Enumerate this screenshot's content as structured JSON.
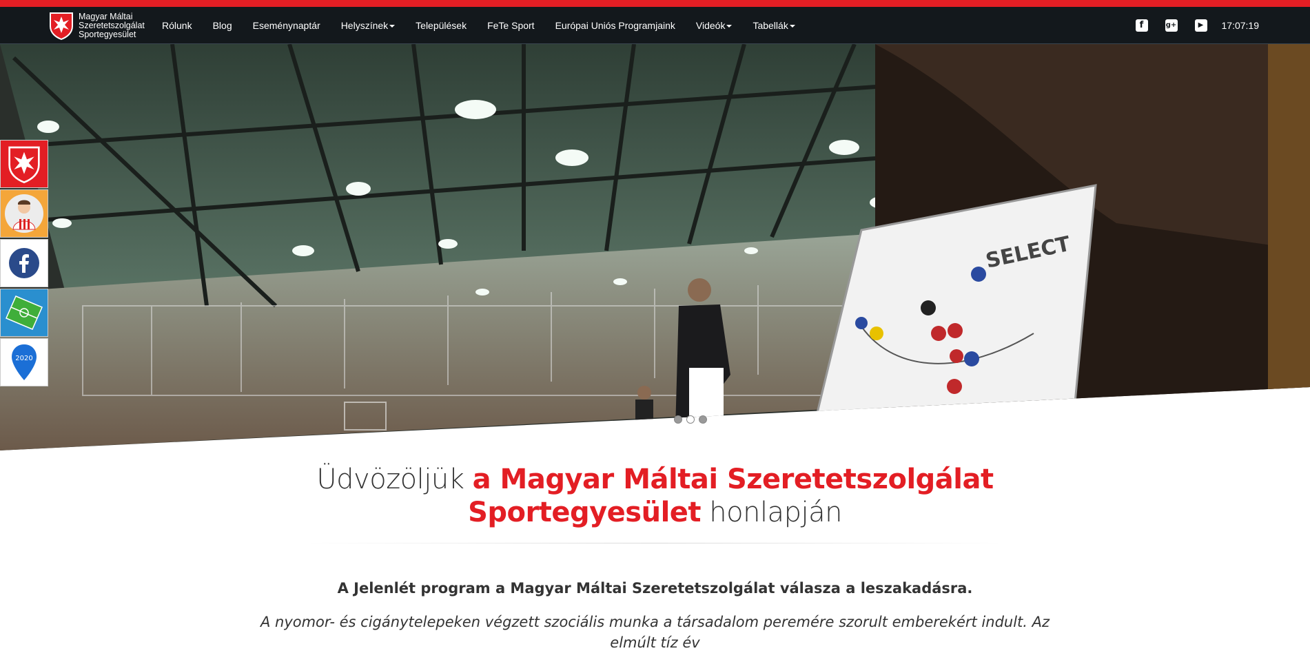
{
  "brand": {
    "name_line1": "Magyar Máltai",
    "name_line2": "Szeretetszolgálat",
    "name_line3": "Sportegyesület"
  },
  "nav": {
    "items": [
      {
        "label": "Rólunk"
      },
      {
        "label": "Blog"
      },
      {
        "label": "Eseménynaptár"
      },
      {
        "label": "Helyszínek"
      },
      {
        "label": "Települések"
      },
      {
        "label": "FeTe Sport"
      },
      {
        "label": "Európai Uniós Programjaink"
      },
      {
        "label": "Videók"
      },
      {
        "label": "Tabellák"
      }
    ],
    "social": {
      "facebook": "f",
      "googleplus": "g+",
      "youtube": "▶"
    },
    "clock": "17:07:19"
  },
  "hero": {
    "board_text": "SELECT"
  },
  "sidebar": {
    "tile5_text": "2020"
  },
  "welcome": {
    "prefix": "Üdvözöljük ",
    "highlight1": "a Magyar Máltai Szeretetszolgálat",
    "highlight2": "Sportegyesület",
    "suffix": " honlapján"
  },
  "content": {
    "lead": "A Jelenlét program a Magyar Máltai Szeretetszolgálat válasza a leszakadásra.",
    "paragraph": "A nyomor- és cigánytelepeken végzett szociális munka a társadalom peremére szorult emberekért indult. Az elmúlt tíz év"
  },
  "colors": {
    "accent": "#e31e24",
    "navbar": "#13181c"
  }
}
